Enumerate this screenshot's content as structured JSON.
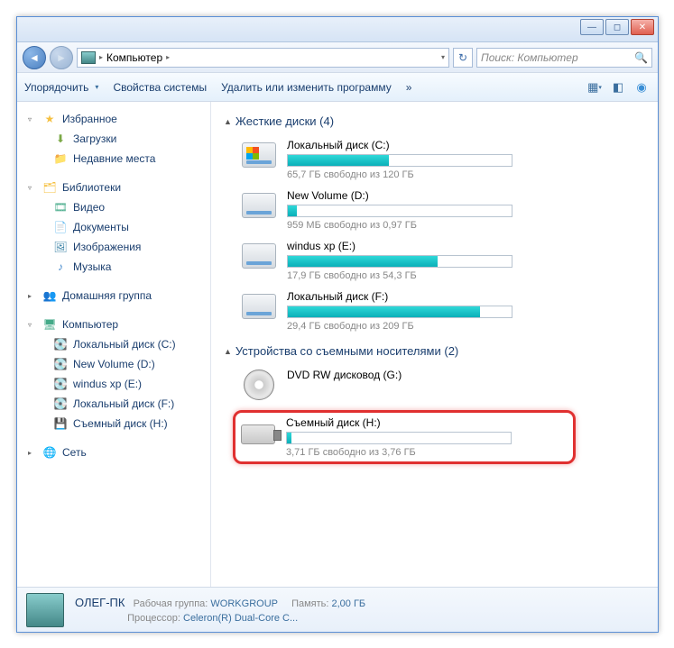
{
  "address": {
    "location": "Компьютер"
  },
  "search": {
    "placeholder": "Поиск: Компьютер"
  },
  "toolbar": {
    "organize": "Упорядочить",
    "properties": "Свойства системы",
    "uninstall": "Удалить или изменить программу",
    "more": "»"
  },
  "sidebar": {
    "favorites": {
      "label": "Избранное",
      "items": [
        {
          "label": "Загрузки"
        },
        {
          "label": "Недавние места"
        }
      ]
    },
    "libraries": {
      "label": "Библиотеки",
      "items": [
        {
          "label": "Видео"
        },
        {
          "label": "Документы"
        },
        {
          "label": "Изображения"
        },
        {
          "label": "Музыка"
        }
      ]
    },
    "homegroup": {
      "label": "Домашняя группа"
    },
    "computer": {
      "label": "Компьютер",
      "items": [
        {
          "label": "Локальный диск (C:)"
        },
        {
          "label": "New Volume (D:)"
        },
        {
          "label": "windus xp (E:)"
        },
        {
          "label": "Локальный диск (F:)"
        },
        {
          "label": "Съемный диск (H:)"
        }
      ]
    },
    "network": {
      "label": "Сеть"
    }
  },
  "content": {
    "hdd_header": "Жесткие диски (4)",
    "drives": [
      {
        "name": "Локальный диск (C:)",
        "free": "65,7 ГБ свободно из 120 ГБ",
        "fill": 45
      },
      {
        "name": "New Volume (D:)",
        "free": "959 МБ свободно из 0,97 ГБ",
        "fill": 4
      },
      {
        "name": "windus xp (E:)",
        "free": "17,9 ГБ свободно из 54,3 ГБ",
        "fill": 67
      },
      {
        "name": "Локальный диск (F:)",
        "free": "29,4 ГБ свободно из 209 ГБ",
        "fill": 86
      }
    ],
    "removable_header": "Устройства со съемными носителями (2)",
    "dvd": {
      "name": "DVD RW дисковод (G:)"
    },
    "usb": {
      "name": "Съемный диск (H:)",
      "free": "3,71 ГБ свободно из 3,76 ГБ",
      "fill": 2
    }
  },
  "status": {
    "name": "ОЛЕГ-ПК",
    "workgroup_lbl": "Рабочая группа:",
    "workgroup": "WORKGROUP",
    "cpu_lbl": "Процессор:",
    "cpu": "Celeron(R) Dual-Core C...",
    "mem_lbl": "Память:",
    "mem": "2,00 ГБ"
  }
}
